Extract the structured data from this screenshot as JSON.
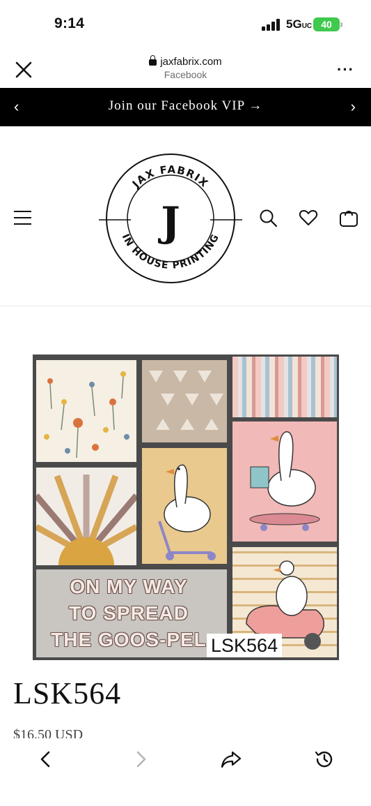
{
  "status": {
    "time": "9:14",
    "network": "5G",
    "network_suffix": "UC",
    "battery": "40"
  },
  "browser": {
    "domain": "jaxfabrix.com",
    "source": "Facebook"
  },
  "announcement": {
    "text": "Join our Facebook VIP →"
  },
  "logo": {
    "top_text": "JAX FABRIX",
    "monogram": "J",
    "bottom_text": "IN HOUSE PRINTING"
  },
  "product": {
    "sku_tag": "LSK564",
    "slogan_lines": [
      "ON MY WAY",
      "TO SPREAD",
      "THE GOOS-PEL"
    ],
    "title": "LSK564",
    "price": "$16.50 USD"
  },
  "icons": {
    "close": "close-icon",
    "more": "more-icon",
    "menu": "menu-icon",
    "search": "search-icon",
    "wishlist": "heart-icon",
    "cart": "cart-icon",
    "back": "back-arrow-icon",
    "forward": "forward-arrow-icon",
    "share": "share-icon",
    "history": "history-icon"
  },
  "colors": {
    "announcement_bg": "#000000",
    "battery": "#3fc94d"
  }
}
